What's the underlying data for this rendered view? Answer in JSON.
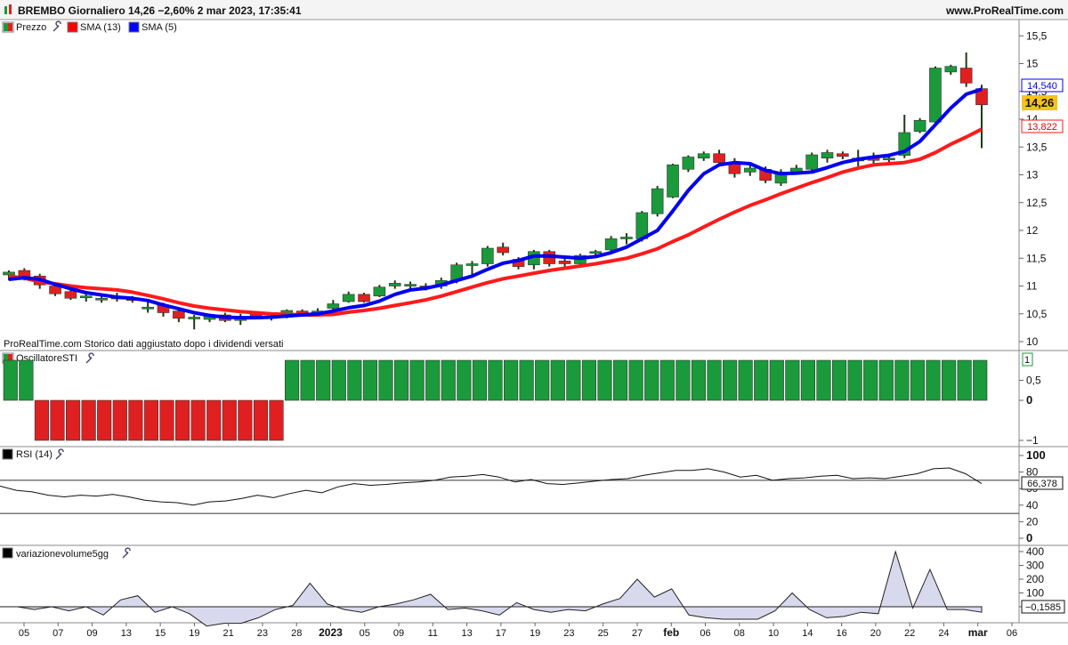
{
  "header": {
    "title": "BREMBO Giornaliero 14,26 −2,60% 2 mar 2023, 17:35:41",
    "site": "www.ProRealTime.com"
  },
  "legend": [
    {
      "label": "Prezzo",
      "color": "#1a9a3a",
      "color2": "#e02020"
    },
    {
      "label": "SMA (13)",
      "color": "#ff0000"
    },
    {
      "label": "SMA (5)",
      "color": "#0000ff"
    }
  ],
  "note": "ProRealTime.com  Storico dati aggiustato dopo i dividendi versati",
  "panels": {
    "sti_label": "OscillatoreSTI",
    "sti_value": "1",
    "rsi_label": "RSI (14)",
    "rsi_value": "66,378",
    "vol_label": "variazionevolume5gg",
    "vol_value": "−0,1585"
  },
  "price_labels": {
    "sma5": "14,540",
    "last": "14,26",
    "sma13": "13,822"
  },
  "colors": {
    "up": "#1a9a3a",
    "down": "#e02020",
    "sma13": "#ff1a1a",
    "sma5": "#0000ee",
    "last_bg": "#f7c21a"
  },
  "chart_data": {
    "type": "candlestick",
    "x_labels": [
      "05",
      "07",
      "09",
      "13",
      "15",
      "19",
      "21",
      "23",
      "28",
      "2023",
      "05",
      "09",
      "11",
      "13",
      "17",
      "19",
      "23",
      "25",
      "27",
      "feb",
      "06",
      "08",
      "10",
      "14",
      "16",
      "20",
      "22",
      "24",
      "mar",
      "06"
    ],
    "price_ticks": [
      "15,5",
      "15",
      "14,5",
      "14",
      "13,5",
      "13",
      "12,5",
      "12",
      "11,5",
      "11",
      "10,5",
      "10"
    ],
    "price_ylim": [
      10,
      15.6
    ],
    "candles": [
      {
        "o": 11.2,
        "h": 11.28,
        "l": 11.1,
        "c": 11.25
      },
      {
        "o": 11.28,
        "h": 11.32,
        "l": 11.1,
        "c": 11.15
      },
      {
        "o": 11.18,
        "h": 11.22,
        "l": 10.95,
        "c": 11.02
      },
      {
        "o": 11.0,
        "h": 11.05,
        "l": 10.82,
        "c": 10.86
      },
      {
        "o": 10.9,
        "h": 10.95,
        "l": 10.75,
        "c": 10.78
      },
      {
        "o": 10.8,
        "h": 10.9,
        "l": 10.72,
        "c": 10.82
      },
      {
        "o": 10.76,
        "h": 10.86,
        "l": 10.7,
        "c": 10.78
      },
      {
        "o": 10.78,
        "h": 10.88,
        "l": 10.72,
        "c": 10.8
      },
      {
        "o": 10.78,
        "h": 10.82,
        "l": 10.7,
        "c": 10.74
      },
      {
        "o": 10.6,
        "h": 10.72,
        "l": 10.52,
        "c": 10.62
      },
      {
        "o": 10.65,
        "h": 10.7,
        "l": 10.45,
        "c": 10.52
      },
      {
        "o": 10.55,
        "h": 10.6,
        "l": 10.35,
        "c": 10.42
      },
      {
        "o": 10.42,
        "h": 10.48,
        "l": 10.22,
        "c": 10.44
      },
      {
        "o": 10.4,
        "h": 10.5,
        "l": 10.35,
        "c": 10.46
      },
      {
        "o": 10.48,
        "h": 10.52,
        "l": 10.35,
        "c": 10.38
      },
      {
        "o": 10.38,
        "h": 10.5,
        "l": 10.3,
        "c": 10.45
      },
      {
        "o": 10.5,
        "h": 10.55,
        "l": 10.4,
        "c": 10.44
      },
      {
        "o": 10.42,
        "h": 10.5,
        "l": 10.38,
        "c": 10.45
      },
      {
        "o": 10.48,
        "h": 10.58,
        "l": 10.42,
        "c": 10.56
      },
      {
        "o": 10.55,
        "h": 10.58,
        "l": 10.45,
        "c": 10.48
      },
      {
        "o": 10.5,
        "h": 10.6,
        "l": 10.45,
        "c": 10.55
      },
      {
        "o": 10.6,
        "h": 10.75,
        "l": 10.55,
        "c": 10.68
      },
      {
        "o": 10.72,
        "h": 10.9,
        "l": 10.7,
        "c": 10.85
      },
      {
        "o": 10.85,
        "h": 10.88,
        "l": 10.7,
        "c": 10.72
      },
      {
        "o": 10.82,
        "h": 11.02,
        "l": 10.8,
        "c": 10.98
      },
      {
        "o": 11.0,
        "h": 11.1,
        "l": 10.95,
        "c": 11.05
      },
      {
        "o": 11.0,
        "h": 11.08,
        "l": 10.96,
        "c": 11.03
      },
      {
        "o": 11.0,
        "h": 11.05,
        "l": 10.92,
        "c": 10.98
      },
      {
        "o": 11.0,
        "h": 11.15,
        "l": 10.95,
        "c": 11.1
      },
      {
        "o": 11.1,
        "h": 11.42,
        "l": 11.05,
        "c": 11.38
      },
      {
        "o": 11.38,
        "h": 11.45,
        "l": 11.2,
        "c": 11.4
      },
      {
        "o": 11.4,
        "h": 11.72,
        "l": 11.35,
        "c": 11.68
      },
      {
        "o": 11.7,
        "h": 11.78,
        "l": 11.55,
        "c": 11.6
      },
      {
        "o": 11.48,
        "h": 11.52,
        "l": 11.3,
        "c": 11.35
      },
      {
        "o": 11.38,
        "h": 11.65,
        "l": 11.3,
        "c": 11.62
      },
      {
        "o": 11.62,
        "h": 11.65,
        "l": 11.35,
        "c": 11.4
      },
      {
        "o": 11.45,
        "h": 11.55,
        "l": 11.35,
        "c": 11.4
      },
      {
        "o": 11.4,
        "h": 11.58,
        "l": 11.38,
        "c": 11.55
      },
      {
        "o": 11.6,
        "h": 11.65,
        "l": 11.5,
        "c": 11.62
      },
      {
        "o": 11.65,
        "h": 11.9,
        "l": 11.62,
        "c": 11.85
      },
      {
        "o": 11.85,
        "h": 11.95,
        "l": 11.75,
        "c": 11.88
      },
      {
        "o": 11.85,
        "h": 12.35,
        "l": 11.8,
        "c": 12.32
      },
      {
        "o": 12.3,
        "h": 12.8,
        "l": 12.25,
        "c": 12.75
      },
      {
        "o": 12.6,
        "h": 13.2,
        "l": 12.58,
        "c": 13.18
      },
      {
        "o": 13.1,
        "h": 13.35,
        "l": 13.05,
        "c": 13.32
      },
      {
        "o": 13.3,
        "h": 13.42,
        "l": 13.25,
        "c": 13.38
      },
      {
        "o": 13.38,
        "h": 13.45,
        "l": 13.15,
        "c": 13.22
      },
      {
        "o": 13.2,
        "h": 13.3,
        "l": 12.95,
        "c": 13.02
      },
      {
        "o": 13.05,
        "h": 13.2,
        "l": 12.98,
        "c": 13.12
      },
      {
        "o": 13.1,
        "h": 13.15,
        "l": 12.85,
        "c": 12.9
      },
      {
        "o": 12.85,
        "h": 13.1,
        "l": 12.8,
        "c": 13.05
      },
      {
        "o": 13.05,
        "h": 13.18,
        "l": 13.0,
        "c": 13.12
      },
      {
        "o": 13.1,
        "h": 13.4,
        "l": 13.05,
        "c": 13.36
      },
      {
        "o": 13.3,
        "h": 13.45,
        "l": 13.22,
        "c": 13.4
      },
      {
        "o": 13.38,
        "h": 13.42,
        "l": 13.28,
        "c": 13.33
      },
      {
        "o": 13.25,
        "h": 13.45,
        "l": 13.15,
        "c": 13.3
      },
      {
        "o": 13.3,
        "h": 13.4,
        "l": 13.15,
        "c": 13.26
      },
      {
        "o": 13.3,
        "h": 13.38,
        "l": 13.2,
        "c": 13.3
      },
      {
        "o": 13.35,
        "h": 14.08,
        "l": 13.3,
        "c": 13.76
      },
      {
        "o": 13.78,
        "h": 14.02,
        "l": 13.75,
        "c": 13.98
      },
      {
        "o": 13.95,
        "h": 14.95,
        "l": 13.92,
        "c": 14.92
      },
      {
        "o": 14.85,
        "h": 14.98,
        "l": 14.8,
        "c": 14.95
      },
      {
        "o": 14.92,
        "h": 15.2,
        "l": 14.58,
        "c": 14.65
      },
      {
        "o": 14.55,
        "h": 14.62,
        "l": 13.48,
        "c": 14.26
      }
    ],
    "sma13": [
      11.18,
      11.14,
      11.08,
      11.04,
      11.0,
      10.97,
      10.95,
      10.93,
      10.89,
      10.83,
      10.77,
      10.7,
      10.64,
      10.6,
      10.57,
      10.54,
      10.52,
      10.5,
      10.49,
      10.48,
      10.48,
      10.49,
      10.53,
      10.56,
      10.6,
      10.65,
      10.7,
      10.75,
      10.82,
      10.9,
      10.98,
      11.06,
      11.13,
      11.18,
      11.23,
      11.28,
      11.32,
      11.36,
      11.4,
      11.45,
      11.5,
      11.58,
      11.67,
      11.8,
      11.92,
      12.06,
      12.2,
      12.33,
      12.45,
      12.55,
      12.66,
      12.76,
      12.86,
      12.95,
      13.05,
      13.12,
      13.18,
      13.2,
      13.22,
      13.28,
      13.4,
      13.55,
      13.68,
      13.82
    ],
    "sma5": [
      11.12,
      11.15,
      11.12,
      11.03,
      10.95,
      10.88,
      10.84,
      10.8,
      10.78,
      10.74,
      10.66,
      10.59,
      10.52,
      10.47,
      10.44,
      10.43,
      10.43,
      10.44,
      10.46,
      10.48,
      10.5,
      10.55,
      10.61,
      10.65,
      10.73,
      10.85,
      10.93,
      10.96,
      11.02,
      11.1,
      11.18,
      11.3,
      11.41,
      11.46,
      11.54,
      11.54,
      11.52,
      11.5,
      11.53,
      11.6,
      11.7,
      11.85,
      12.0,
      12.35,
      12.72,
      13.02,
      13.18,
      13.22,
      13.2,
      13.08,
      13.02,
      13.03,
      13.05,
      13.13,
      13.22,
      13.28,
      13.32,
      13.35,
      13.42,
      13.6,
      13.9,
      14.2,
      14.45,
      14.54
    ],
    "sti": [
      1,
      1,
      -1,
      -1,
      -1,
      -1,
      -1,
      -1,
      -1,
      -1,
      -1,
      -1,
      -1,
      -1,
      -1,
      -1,
      -1,
      -1,
      1,
      1,
      1,
      1,
      1,
      1,
      1,
      1,
      1,
      1,
      1,
      1,
      1,
      1,
      1,
      1,
      1,
      1,
      1,
      1,
      1,
      1,
      1,
      1,
      1,
      1,
      1,
      1,
      1,
      1,
      1,
      1,
      1,
      1,
      1,
      1,
      1,
      1,
      1,
      1,
      1,
      1,
      1,
      1,
      1
    ],
    "sti_ticks": [
      "0,5",
      "0",
      "−1"
    ],
    "rsi": [
      63,
      58,
      56,
      52,
      50,
      52,
      51,
      53,
      50,
      46,
      44,
      43,
      40,
      44,
      45,
      48,
      52,
      49,
      54,
      58,
      55,
      62,
      66,
      64,
      65,
      67,
      68,
      70,
      74,
      75,
      77,
      74,
      68,
      71,
      66,
      65,
      67,
      69,
      71,
      72,
      76,
      79,
      82,
      82,
      84,
      80,
      74,
      76,
      70,
      72,
      73,
      75,
      76,
      72,
      73,
      72,
      75,
      78,
      84,
      85,
      78,
      66
    ],
    "rsi_ticks": [
      "100",
      "80",
      "60",
      "40",
      "20",
      "0"
    ],
    "rsi_levels": [
      70,
      30
    ],
    "vol": [
      0,
      0,
      -20,
      0,
      -30,
      0,
      -60,
      50,
      80,
      -40,
      0,
      -50,
      -140,
      -120,
      -120,
      -80,
      -20,
      10,
      170,
      20,
      -20,
      -40,
      0,
      20,
      50,
      90,
      -20,
      -10,
      -30,
      -60,
      30,
      -20,
      -40,
      -20,
      -30,
      20,
      60,
      200,
      70,
      130,
      -60,
      -80,
      -90,
      -90,
      -90,
      -30,
      100,
      -20,
      -80,
      -70,
      -40,
      -50,
      400,
      -10,
      270,
      -20,
      -20,
      -40
    ],
    "vol_ticks": [
      "400",
      "300",
      "200",
      "100",
      "0"
    ]
  }
}
